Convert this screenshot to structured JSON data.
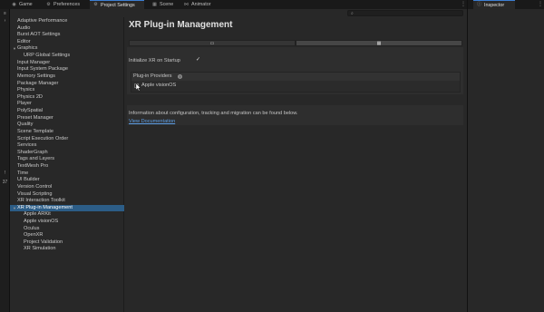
{
  "tabs": {
    "game": "Game",
    "preferences": "Preferences",
    "project_settings": "Project Settings",
    "scene": "Scene",
    "animator": "Animator",
    "inspector": "Inspector"
  },
  "left_strip": {
    "number": "37"
  },
  "sidebar": {
    "items": [
      "Adaptive Performance",
      "Audio",
      "Burst AOT Settings",
      "Editor",
      "Graphics",
      "URP Global Settings",
      "Input Manager",
      "Input System Package",
      "Memory Settings",
      "Package Manager",
      "Physics",
      "Physics 2D",
      "Player",
      "PolySpatial",
      "Preset Manager",
      "Quality",
      "Scene Template",
      "Script Execution Order",
      "Services",
      "ShaderGraph",
      "Tags and Layers",
      "TextMesh Pro",
      "Time",
      "UI Builder",
      "Version Control",
      "Visual Scripting",
      "XR Interaction Toolkit",
      "XR Plug-in Management",
      "Apple ARKit",
      "Apple visionOS",
      "Oculus",
      "OpenXR",
      "Project Validation",
      "XR Simulation"
    ],
    "selected": "XR Plug-in Management"
  },
  "content": {
    "title": "XR Plug-in Management",
    "initialize_label": "Initialize XR on Startup",
    "initialize_checked": true,
    "providers_title": "Plug-in Providers",
    "provider_label": "Apple visionOS",
    "provider_checked": false,
    "info_text": "Information about configuration, tracking and migration can be found below.",
    "doc_link": "View Documentation"
  },
  "colors": {
    "selection": "#2c5d87",
    "link": "#5c9ee6",
    "active_tab_accent": "#3d7fd3"
  }
}
